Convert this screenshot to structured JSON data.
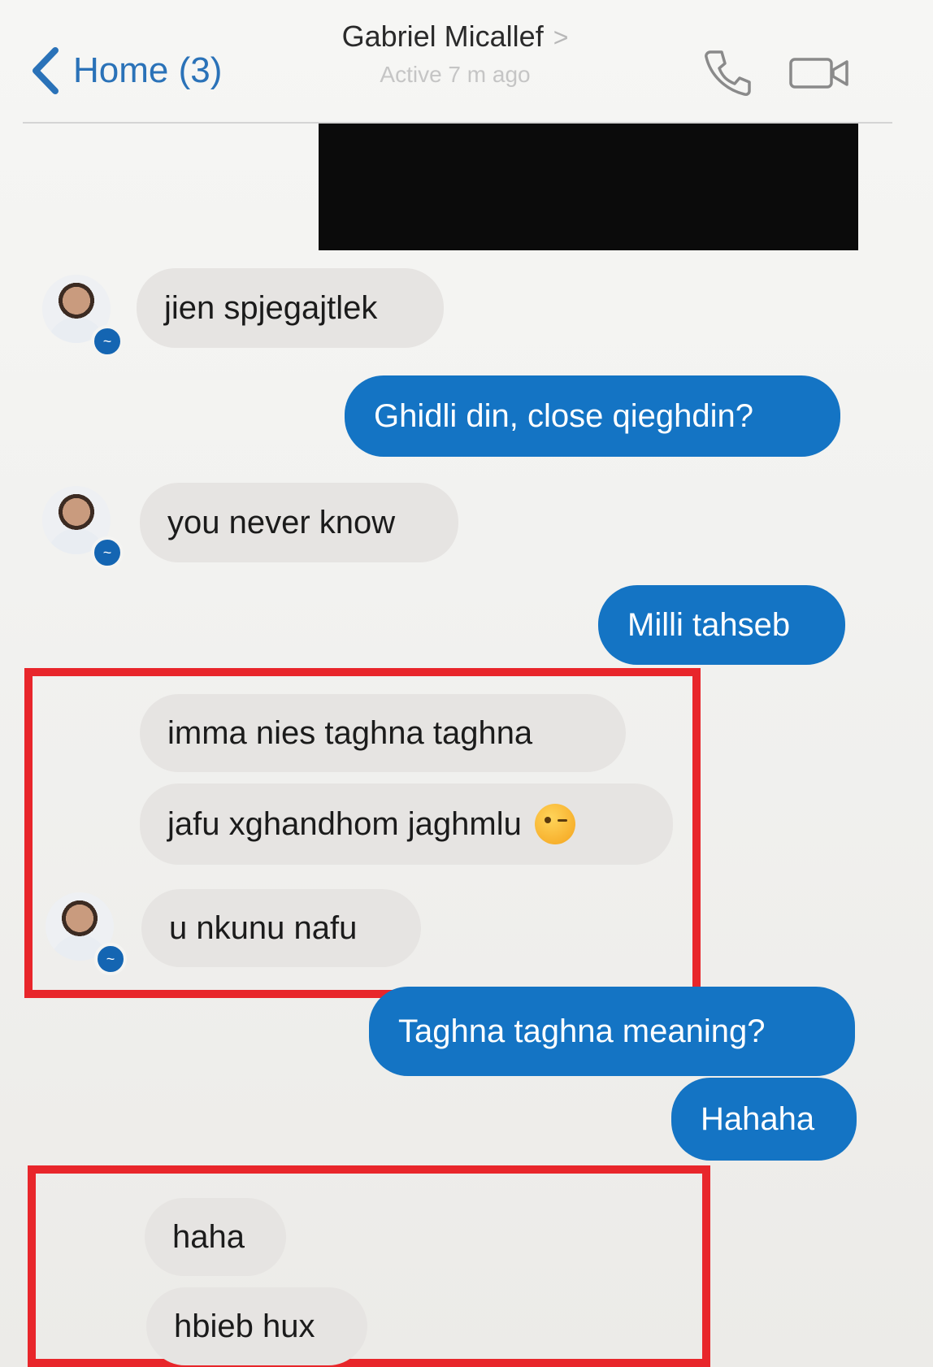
{
  "header": {
    "back_label": "Home (3)",
    "contact_name": "Gabriel Micallef",
    "name_chevron": ">",
    "status": "Active 7 m ago"
  },
  "messages": [
    {
      "from": "contact",
      "text": "jien spjegajtlek"
    },
    {
      "from": "me",
      "text": "Ghidli din, close qieghdin?"
    },
    {
      "from": "contact",
      "text": "you never know"
    },
    {
      "from": "me",
      "text": "Milli tahseb"
    },
    {
      "from": "contact",
      "text": "imma nies taghna taghna"
    },
    {
      "from": "contact",
      "text": "jafu xghandhom jaghmlu",
      "emoji": "winking-face"
    },
    {
      "from": "contact",
      "text": "u nkunu nafu"
    },
    {
      "from": "me",
      "text": "Taghna taghna meaning?"
    },
    {
      "from": "me",
      "text": "Hahaha"
    },
    {
      "from": "contact",
      "text": "haha"
    },
    {
      "from": "contact",
      "text": "hbieb hux"
    }
  ],
  "icons": {
    "back": "chevron-left-icon",
    "phone": "phone-icon",
    "video": "video-camera-icon",
    "avatar_badge": "messenger-badge-icon"
  },
  "colors": {
    "outgoing_bubble": "#1474c4",
    "incoming_bubble": "#e6e4e2",
    "accent": "#2a72b8",
    "highlight_border": "#e8262b",
    "redaction": "#0b0b0b"
  }
}
